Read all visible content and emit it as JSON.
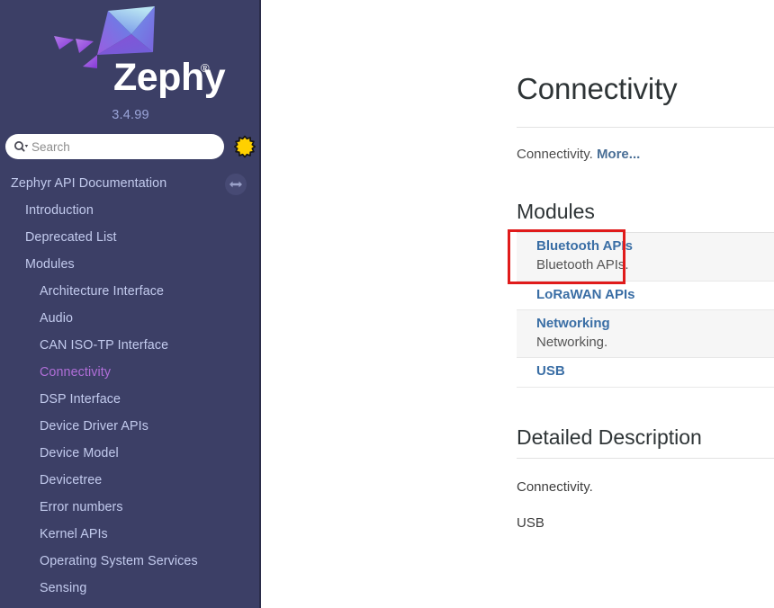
{
  "sidebar": {
    "brand": "Zephyr",
    "brand_trademark": "®",
    "version": "3.4.99",
    "search": {
      "placeholder": "Search",
      "value": "",
      "icon": "search-icon"
    },
    "star_icon": "starburst-icon",
    "expand_icon": "left-right-arrow-icon",
    "nav": [
      {
        "label": "Zephyr API Documentation",
        "level": 0,
        "active": false
      },
      {
        "label": "Introduction",
        "level": 1,
        "active": false
      },
      {
        "label": "Deprecated List",
        "level": 1,
        "active": false
      },
      {
        "label": "Modules",
        "level": 1,
        "active": false
      },
      {
        "label": "Architecture Interface",
        "level": 2,
        "active": false
      },
      {
        "label": "Audio",
        "level": 2,
        "active": false
      },
      {
        "label": "CAN ISO-TP Interface",
        "level": 2,
        "active": false
      },
      {
        "label": "Connectivity",
        "level": 2,
        "active": true
      },
      {
        "label": "DSP Interface",
        "level": 2,
        "active": false
      },
      {
        "label": "Device Driver APIs",
        "level": 2,
        "active": false
      },
      {
        "label": "Device Model",
        "level": 2,
        "active": false
      },
      {
        "label": "Devicetree",
        "level": 2,
        "active": false
      },
      {
        "label": "Error numbers",
        "level": 2,
        "active": false
      },
      {
        "label": "Kernel APIs",
        "level": 2,
        "active": false
      },
      {
        "label": "Operating System Services",
        "level": 2,
        "active": false
      },
      {
        "label": "Sensing",
        "level": 2,
        "active": false
      }
    ]
  },
  "content": {
    "title": "Connectivity",
    "brief_text": "Connectivity. ",
    "brief_more": "More...",
    "modules_heading": "Modules",
    "modules": [
      {
        "name": "Bluetooth APIs",
        "description": "Bluetooth APIs."
      },
      {
        "name": "LoRaWAN APIs",
        "description": ""
      },
      {
        "name": "Networking",
        "description": "Networking."
      },
      {
        "name": "USB",
        "description": ""
      }
    ],
    "detailed_heading": "Detailed Description",
    "detailed_paragraphs": [
      "Connectivity.",
      "USB"
    ]
  },
  "annotation": {
    "highlight_target": "Bluetooth APIs",
    "color": "#e01b1b"
  },
  "theme": {
    "sidebar_bg": "#3c3f66",
    "sidebar_text": "#c3cbee",
    "sidebar_active": "#b06ed8",
    "link_blue": "#3a6ea5",
    "star_yellow": "#ffd700"
  }
}
